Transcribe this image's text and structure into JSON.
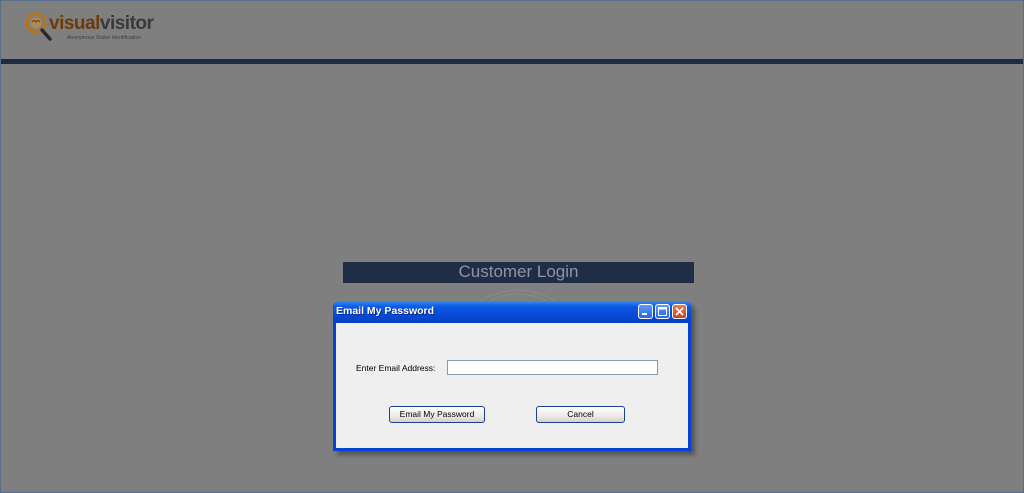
{
  "header": {
    "logo": {
      "visual": "visual",
      "visitor": "visitor",
      "tagline": "Anonymous Visitor Identification"
    },
    "accent_color": "#1d2c44"
  },
  "login_panel": {
    "title": "Customer Login"
  },
  "dialog": {
    "title": "Email My Password",
    "controls": {
      "minimize_icon": "minimize-icon",
      "maximize_icon": "maximize-icon",
      "close_icon": "close-icon"
    },
    "email_label": "Enter Email Address:",
    "email_value": "",
    "email_placeholder": "",
    "submit_label": "Email My Password",
    "cancel_label": "Cancel"
  },
  "colors": {
    "background": "#7f7f7f",
    "titlebar": "#0647d4",
    "dialog_body": "#efefef"
  }
}
